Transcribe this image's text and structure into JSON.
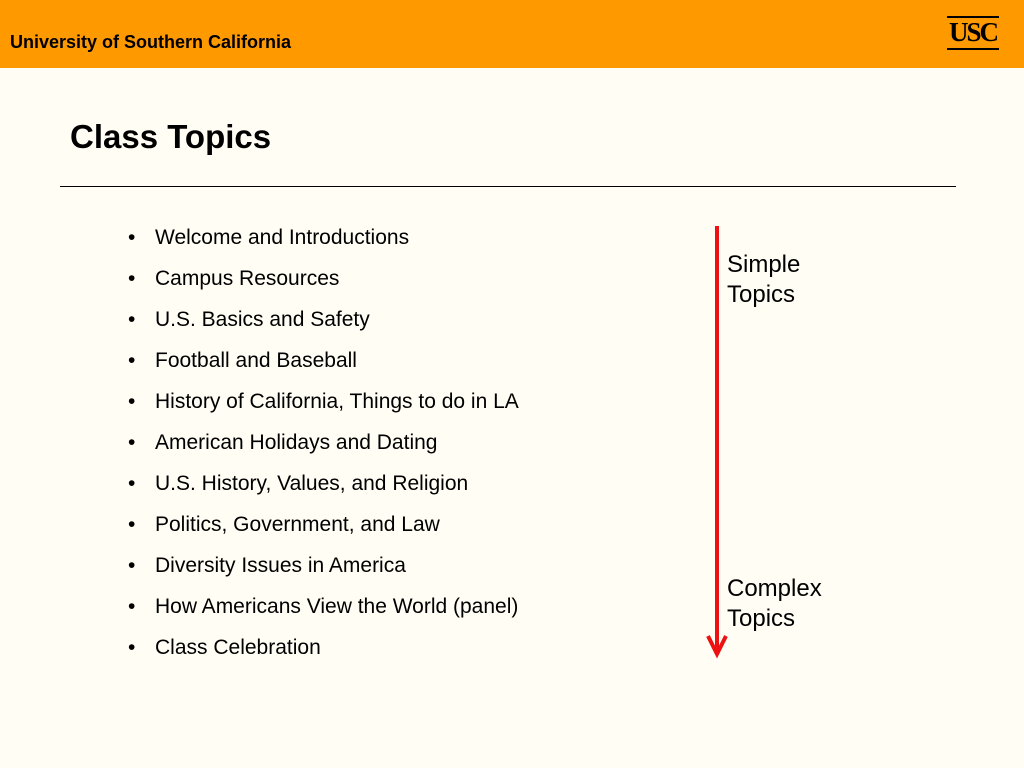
{
  "header": {
    "institution": "University of Southern California",
    "logo_text": "USC"
  },
  "slide": {
    "title": "Class Topics",
    "topics": [
      "Welcome and Introductions",
      "Campus Resources",
      "U.S. Basics and Safety",
      "Football and Baseball",
      "History of California, Things to do in LA",
      "American Holidays and Dating",
      "U.S. History, Values, and Religion",
      "Politics, Government, and Law",
      "Diversity Issues in America",
      "How Americans View the World (panel)",
      "Class Celebration"
    ],
    "arrow": {
      "top_label_1": "Simple",
      "top_label_2": "Topics",
      "bottom_label_1": "Complex",
      "bottom_label_2": "Topics",
      "color": "#ee1111"
    }
  },
  "colors": {
    "header": "#ff9900",
    "background": "#fffdf4"
  }
}
